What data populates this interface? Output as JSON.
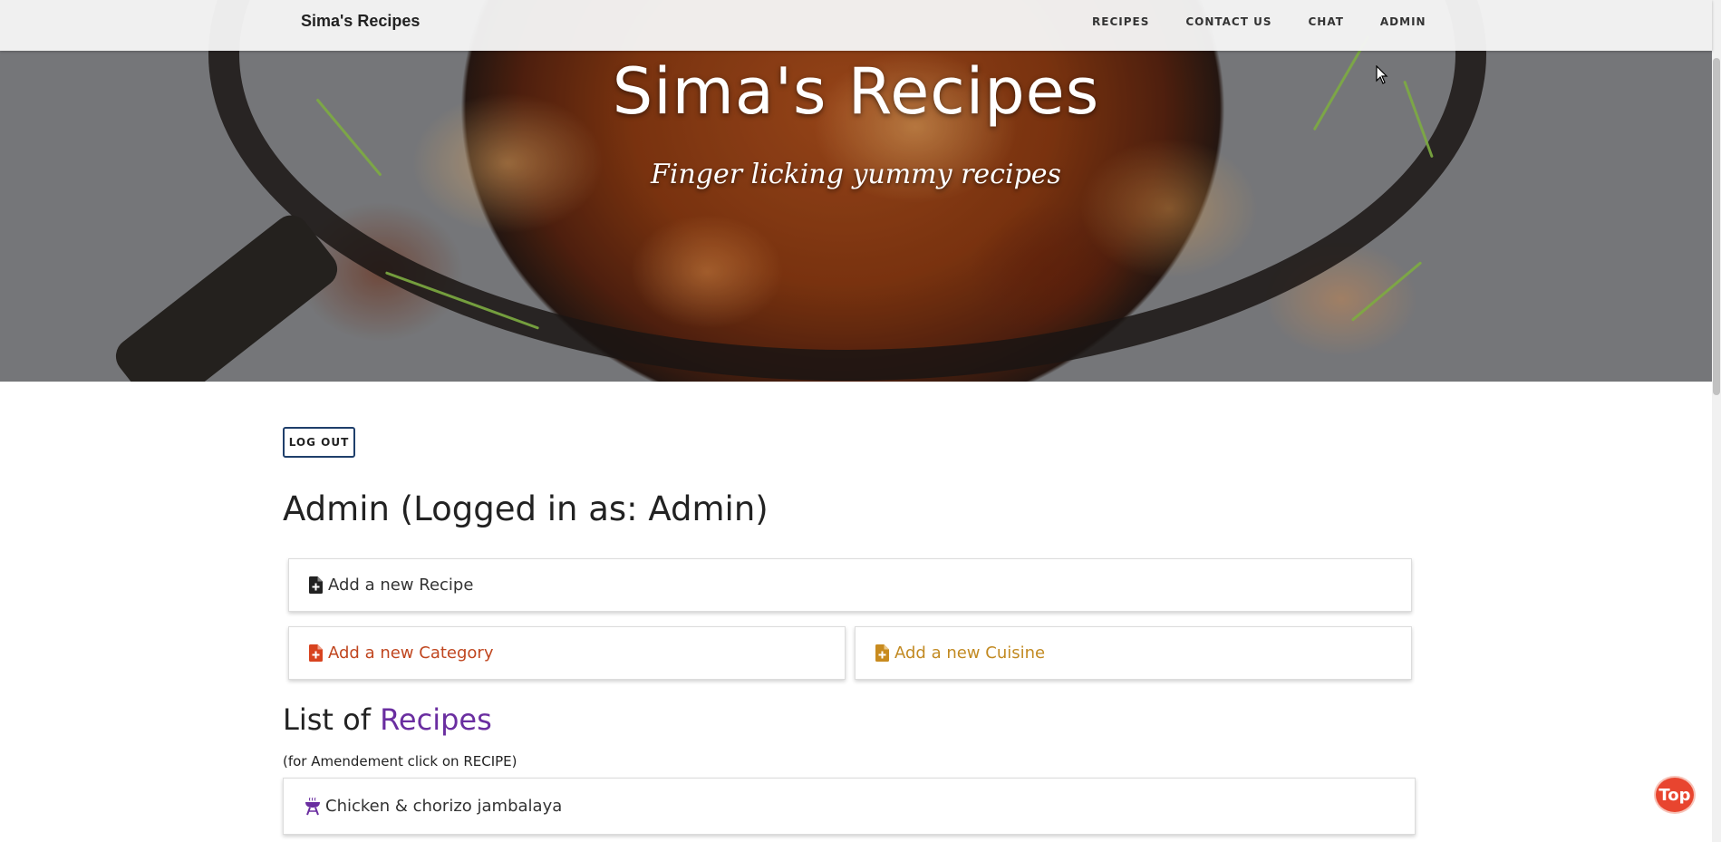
{
  "navbar": {
    "brand": "Sima's Recipes",
    "links": [
      "RECIPES",
      "CONTACT US",
      "CHAT",
      "ADMIN"
    ]
  },
  "hero": {
    "title": "Sima's Recipes",
    "subtitle": "Finger licking yummy recipes"
  },
  "admin": {
    "logout_label": "LOG OUT",
    "heading": "Admin (Logged in as: Admin)",
    "add_recipe": "Add a new Recipe",
    "add_category": "Add a new Category",
    "add_cuisine": "Add a new Cuisine"
  },
  "recipes": {
    "heading_prefix": "List of",
    "heading_accent": "Recipes",
    "note": "(for Amendement click on RECIPE)",
    "items": [
      "Chicken & chorizo jambalaya"
    ]
  },
  "top_button": "Top",
  "colors": {
    "category": "#c0461f",
    "cuisine": "#c28a22",
    "accent": "#6a2ea0",
    "top_button": "#e8452f"
  },
  "icons": {
    "add_recipe": "file-plus-icon",
    "add_category": "file-plus-icon",
    "add_cuisine": "file-plus-icon",
    "recipe_item": "bbq-grill-icon"
  }
}
